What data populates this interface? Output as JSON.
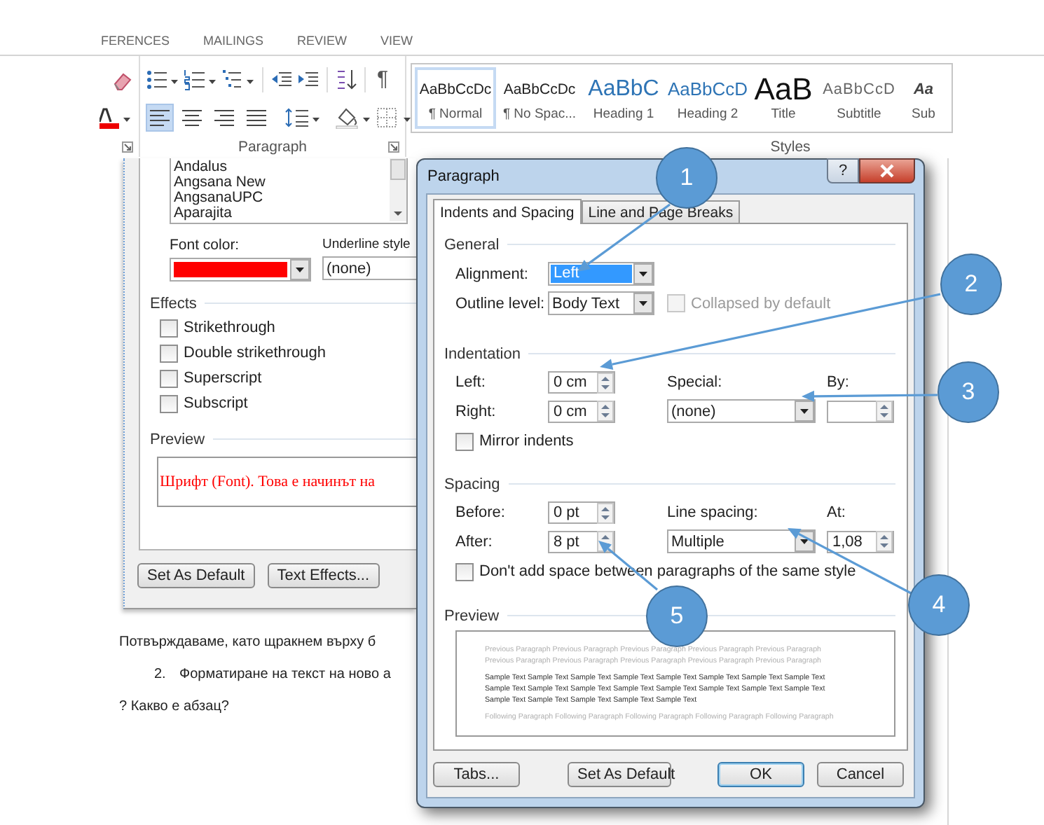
{
  "ribbon_tabs": [
    {
      "label": "FERENCES"
    },
    {
      "label": "MAILINGS"
    },
    {
      "label": "REVIEW"
    },
    {
      "label": "VIEW"
    }
  ],
  "paragraph_group": {
    "label": "Paragraph",
    "show_marks": "¶",
    "align_buttons": [
      {
        "kind": "left",
        "selected": true
      },
      {
        "kind": "center",
        "selected": false
      },
      {
        "kind": "right",
        "selected": false
      },
      {
        "kind": "justify",
        "selected": false
      }
    ]
  },
  "styles_group": {
    "label": "Styles",
    "items": [
      {
        "kind": "normal",
        "preview": "AaBbCcDc",
        "name": "¶ Normal",
        "selected": true
      },
      {
        "kind": "nospacing",
        "preview": "AaBbCcDc",
        "name": "¶ No Spac...",
        "selected": false
      },
      {
        "kind": "heading1",
        "preview": "AaBbC",
        "name": "Heading 1",
        "selected": false
      },
      {
        "kind": "heading2",
        "preview": "AaBbCcD",
        "name": "Heading 2",
        "selected": false
      },
      {
        "kind": "title",
        "preview": "AaB",
        "name": "Title",
        "selected": false
      },
      {
        "kind": "subtitle",
        "preview": "AaBbCcD",
        "name": "Subtitle",
        "selected": false
      },
      {
        "kind": "emphasis",
        "preview": "Aa",
        "name": "Sub",
        "selected": false
      }
    ]
  },
  "document": {
    "paragraphs": [
      {
        "kind": "plain",
        "text": "Потвърждаваме, като щракнем върху б"
      },
      {
        "kind": "numbered",
        "number": "2.",
        "text": "Форматиране на текст на ново а"
      },
      {
        "kind": "plain",
        "text": "? Какво е абзац?"
      }
    ]
  },
  "font_dialog": {
    "fonts": [
      "Andalus",
      "Angsana New",
      "AngsanaUPC",
      "Aparajita"
    ],
    "font_color": {
      "label": "Font color:",
      "color": "#ff0000"
    },
    "underline_label": "Underline style",
    "underline_value": "(none)",
    "effects_label": "Effects",
    "effects": [
      {
        "label": "Strikethrough",
        "checked": false
      },
      {
        "label": "Double strikethrough",
        "checked": false
      },
      {
        "label": "Superscript",
        "checked": false
      },
      {
        "label": "Subscript",
        "checked": false
      }
    ],
    "preview_label": "Preview",
    "preview_text": "Шрифт (Font). Това е начинът на",
    "buttons": [
      "Set As Default",
      "Text Effects..."
    ]
  },
  "paragraph_dialog": {
    "title": "Paragraph",
    "help": "?",
    "tabs": [
      {
        "label": "Indents and Spacing",
        "selected": true
      },
      {
        "label": "Line and Page Breaks",
        "selected": false
      }
    ],
    "general": {
      "label": "General",
      "alignment_label": "Alignment:",
      "alignment_value": "Left",
      "alignment_focused": true,
      "outline_label": "Outline level:",
      "outline_value": "Body Text",
      "collapsed": {
        "label": "Collapsed by default",
        "checked": false,
        "disabled": true
      }
    },
    "indentation": {
      "label": "Indentation",
      "left_label": "Left:",
      "left_value": "0 cm",
      "right_label": "Right:",
      "right_value": "0 cm",
      "special_label": "Special:",
      "special_value": "(none)",
      "by_label": "By:",
      "mirror": {
        "label": "Mirror indents",
        "checked": false
      }
    },
    "spacing": {
      "label": "Spacing",
      "before_label": "Before:",
      "before_value": "0 pt",
      "after_label": "After:",
      "after_value": "8 pt",
      "line_label": "Line spacing:",
      "line_value": "Multiple",
      "at_label": "At:",
      "at_value": "1,08",
      "dont_add": {
        "label": "Don't add space between paragraphs of the same style",
        "checked": false
      }
    },
    "preview": {
      "label": "Preview",
      "previous_lines": [
        "Previous Paragraph Previous Paragraph Previous Paragraph Previous Paragraph Previous Paragraph",
        "Previous Paragraph Previous Paragraph Previous Paragraph Previous Paragraph Previous Paragraph"
      ],
      "sample_lines": [
        "Sample Text Sample Text Sample Text Sample Text Sample Text Sample Text Sample Text Sample Text",
        "Sample Text Sample Text Sample Text Sample Text Sample Text Sample Text Sample Text Sample Text",
        "Sample Text Sample Text Sample Text Sample Text Sample Text"
      ],
      "following_lines": [
        "Following Paragraph Following Paragraph Following Paragraph Following Paragraph Following Paragraph"
      ]
    },
    "buttons": [
      {
        "label": "Tabs...",
        "default": false
      },
      {
        "label": "Set As Default",
        "default": false
      },
      {
        "label": "OK",
        "default": true
      },
      {
        "label": "Cancel",
        "default": false
      }
    ]
  },
  "callouts": [
    {
      "label": "1"
    },
    {
      "label": "2"
    },
    {
      "label": "3"
    },
    {
      "label": "4"
    },
    {
      "label": "5"
    }
  ]
}
